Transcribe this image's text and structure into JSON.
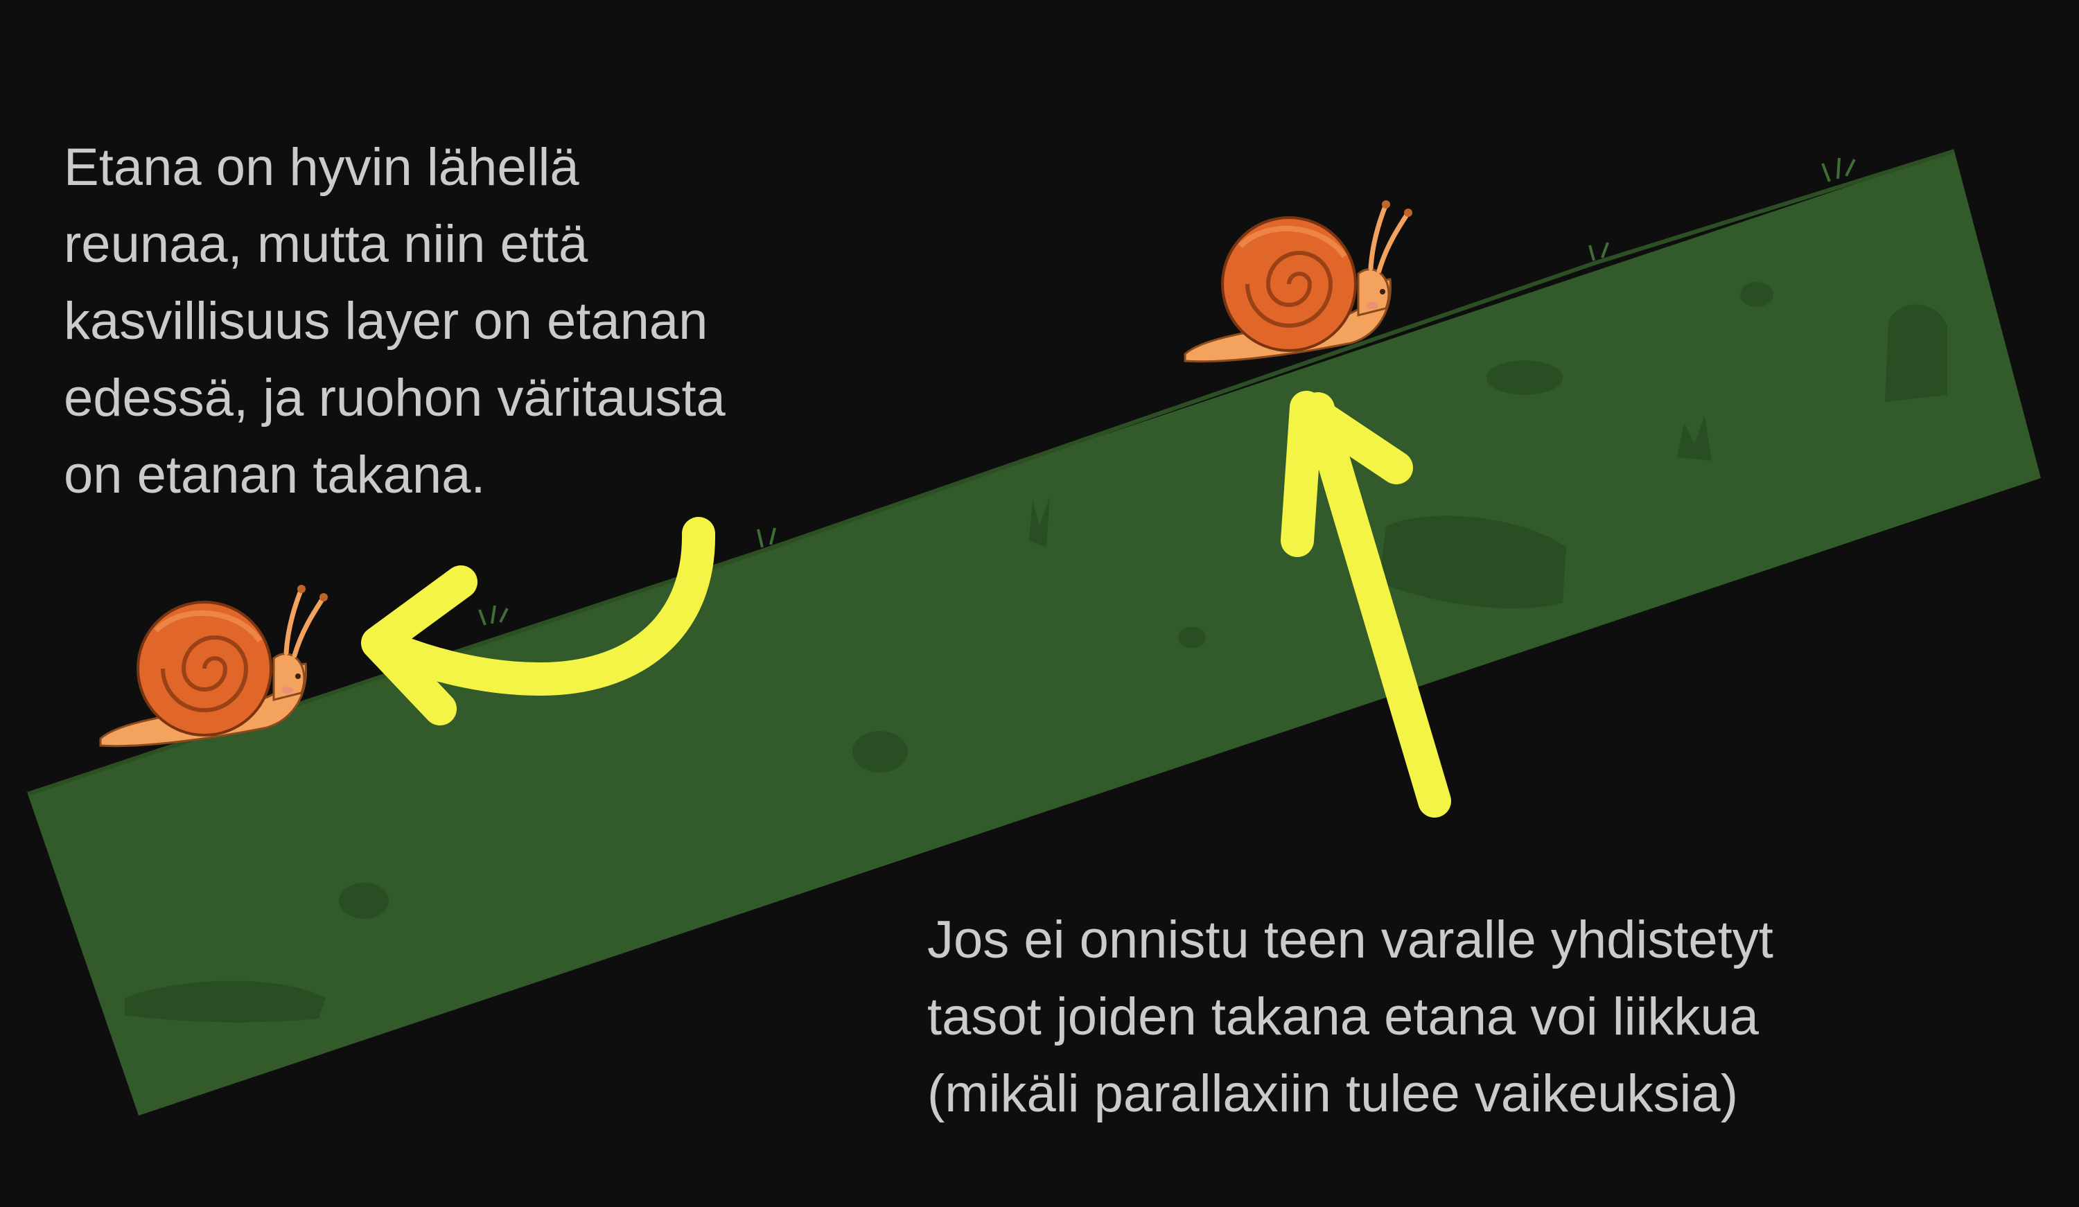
{
  "diagram": {
    "note_left": {
      "lines": [
        "Etana on hyvin lähellä",
        "reunaa, mutta niin että",
        "kasvillisuus layer on etanan",
        "edessä, ja ruohon väritausta",
        "on etanan takana."
      ]
    },
    "note_right": {
      "lines": [
        "Jos ei onnistu teen varalle yhdistetyt",
        "tasot joiden takana etana voi liikkua",
        "(mikäli parallaxiin tulee vaikeuksia)"
      ]
    },
    "colors": {
      "background": "#0e0e0e",
      "ground": "#335a2b",
      "ground_detail": "#284c22",
      "arrow": "#f4f446",
      "text": "#c9ccc9",
      "snail_shell": "#e0662a",
      "snail_body": "#f4a35e"
    },
    "icons": [
      "snail-icon",
      "curved-arrow-icon",
      "straight-arrow-icon",
      "grass-strip"
    ]
  }
}
